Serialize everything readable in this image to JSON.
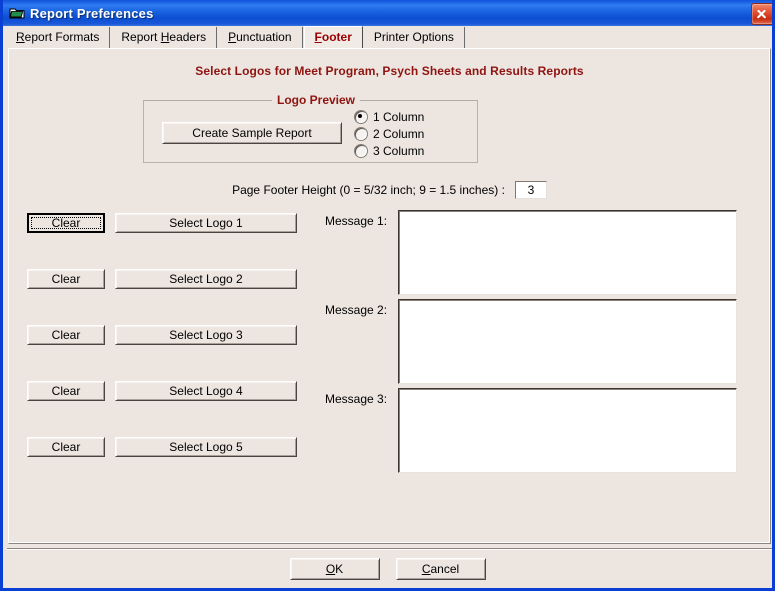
{
  "window": {
    "title": "Report Preferences",
    "icon": "folder-report-icon",
    "close_label": "✕",
    "accent_titlebar": "#1253d8",
    "accent_heading": "#8f1410",
    "face_color": "#ece5e0"
  },
  "tabs": [
    {
      "label": "Report Formats",
      "accel": "R",
      "active": false,
      "name": "tab-report-formats"
    },
    {
      "label": "Report Headers",
      "accel": "H",
      "active": false,
      "name": "tab-report-headers"
    },
    {
      "label": "Punctuation",
      "accel": "P",
      "active": false,
      "name": "tab-punctuation"
    },
    {
      "label": "Footer",
      "accel": "F",
      "active": true,
      "name": "tab-footer"
    },
    {
      "label": "Printer Options",
      "accel": "",
      "active": false,
      "name": "tab-printer-options"
    }
  ],
  "page": {
    "heading": "Select Logos for Meet Program, Psych Sheets and Results Reports"
  },
  "logo_preview": {
    "legend": "Logo Preview",
    "create_sample_label": "Create Sample Report",
    "columns": [
      {
        "label": "1 Column",
        "checked": true
      },
      {
        "label": "2 Column",
        "checked": false
      },
      {
        "label": "3 Column",
        "checked": false
      }
    ]
  },
  "footer_height": {
    "label": "Page Footer Height (0 = 5/32 inch; 9 = 1.5 inches) :",
    "value": "3",
    "placeholder": ""
  },
  "logos": [
    {
      "clear_label": "Clear",
      "select_label": "Select Logo 1",
      "focused": true
    },
    {
      "clear_label": "Clear",
      "select_label": "Select Logo 2",
      "focused": false
    },
    {
      "clear_label": "Clear",
      "select_label": "Select Logo 3",
      "focused": false
    },
    {
      "clear_label": "Clear",
      "select_label": "Select Logo 4",
      "focused": false
    },
    {
      "clear_label": "Clear",
      "select_label": "Select Logo 5",
      "focused": false
    }
  ],
  "messages": [
    {
      "label": "Message 1:",
      "value": "",
      "placeholder": ""
    },
    {
      "label": "Message 2:",
      "value": "",
      "placeholder": ""
    },
    {
      "label": "Message 3:",
      "value": "",
      "placeholder": ""
    }
  ],
  "footer_buttons": {
    "ok_label": "OK",
    "ok_accel": "O",
    "cancel_label": "Cancel",
    "cancel_accel": "C"
  }
}
